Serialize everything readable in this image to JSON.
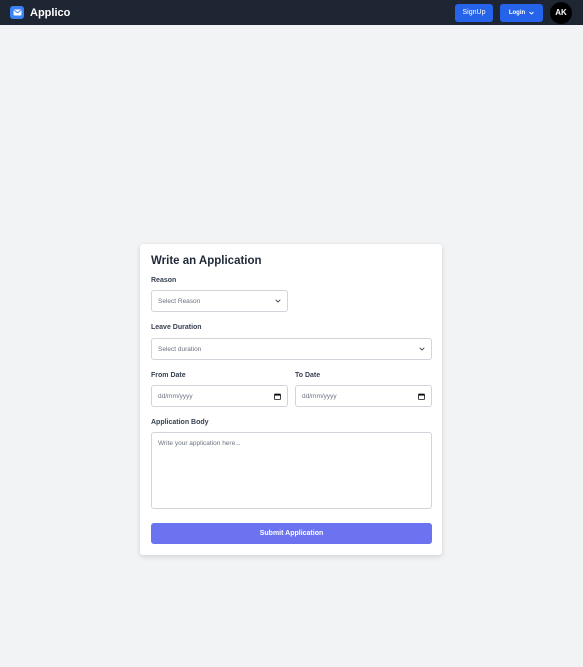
{
  "navbar": {
    "brand_name": "Applico",
    "signup_label": "SignUp",
    "login_label": "Login",
    "avatar_initials": "AK",
    "brand_icon": "envelope-icon"
  },
  "form": {
    "title": "Write an Application",
    "reason_label": "Reason",
    "reason_value": "Select Reason",
    "duration_label": "Leave Duration",
    "duration_value": "Select duration",
    "from_label": "From Date",
    "from_placeholder": "dd/mm/yyyy",
    "to_label": "To Date",
    "to_placeholder": "dd/mm/yyyy",
    "body_label": "Application Body",
    "body_placeholder": "Write your application here...",
    "submit_label": "Submit Application"
  },
  "colors": {
    "navbar_bg": "#1e2533",
    "primary": "#2563eb",
    "submit": "#6b73f0",
    "page_bg": "#f2f3f5"
  }
}
